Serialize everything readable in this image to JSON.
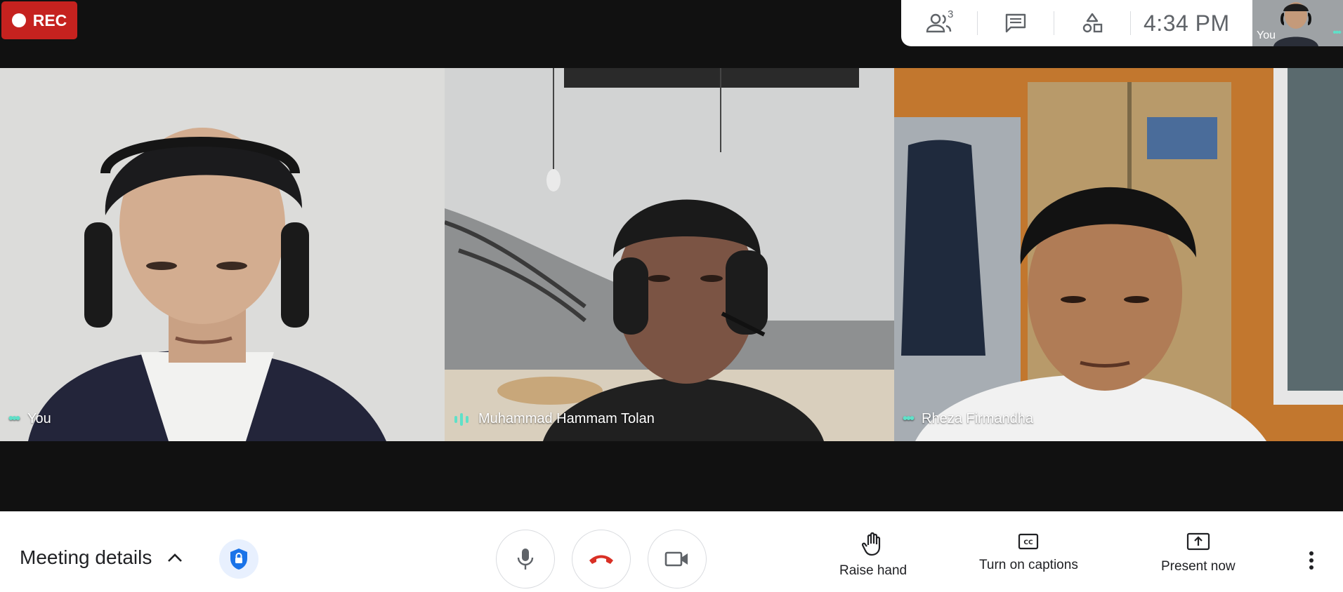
{
  "recording": {
    "label": "REC",
    "color": "#c5221f"
  },
  "topbar": {
    "people_count": "3",
    "time": "4:34 PM",
    "icons": [
      "people-icon",
      "chat-icon",
      "activities-icon"
    ]
  },
  "self_preview": {
    "label": "You"
  },
  "participants": [
    {
      "name": "You",
      "indicator": "more-dots"
    },
    {
      "name": "Muhammad Hammam Tolan",
      "indicator": "speaking"
    },
    {
      "name": "Rheza Firmandha",
      "indicator": "more-dots"
    }
  ],
  "bottombar": {
    "meeting_details": "Meeting details",
    "raise_hand": "Raise hand",
    "captions": "Turn on captions",
    "present": "Present now"
  },
  "colors": {
    "accent": "#1a73e8",
    "hangup": "#d93025",
    "indicator": "#5fe0c8"
  }
}
